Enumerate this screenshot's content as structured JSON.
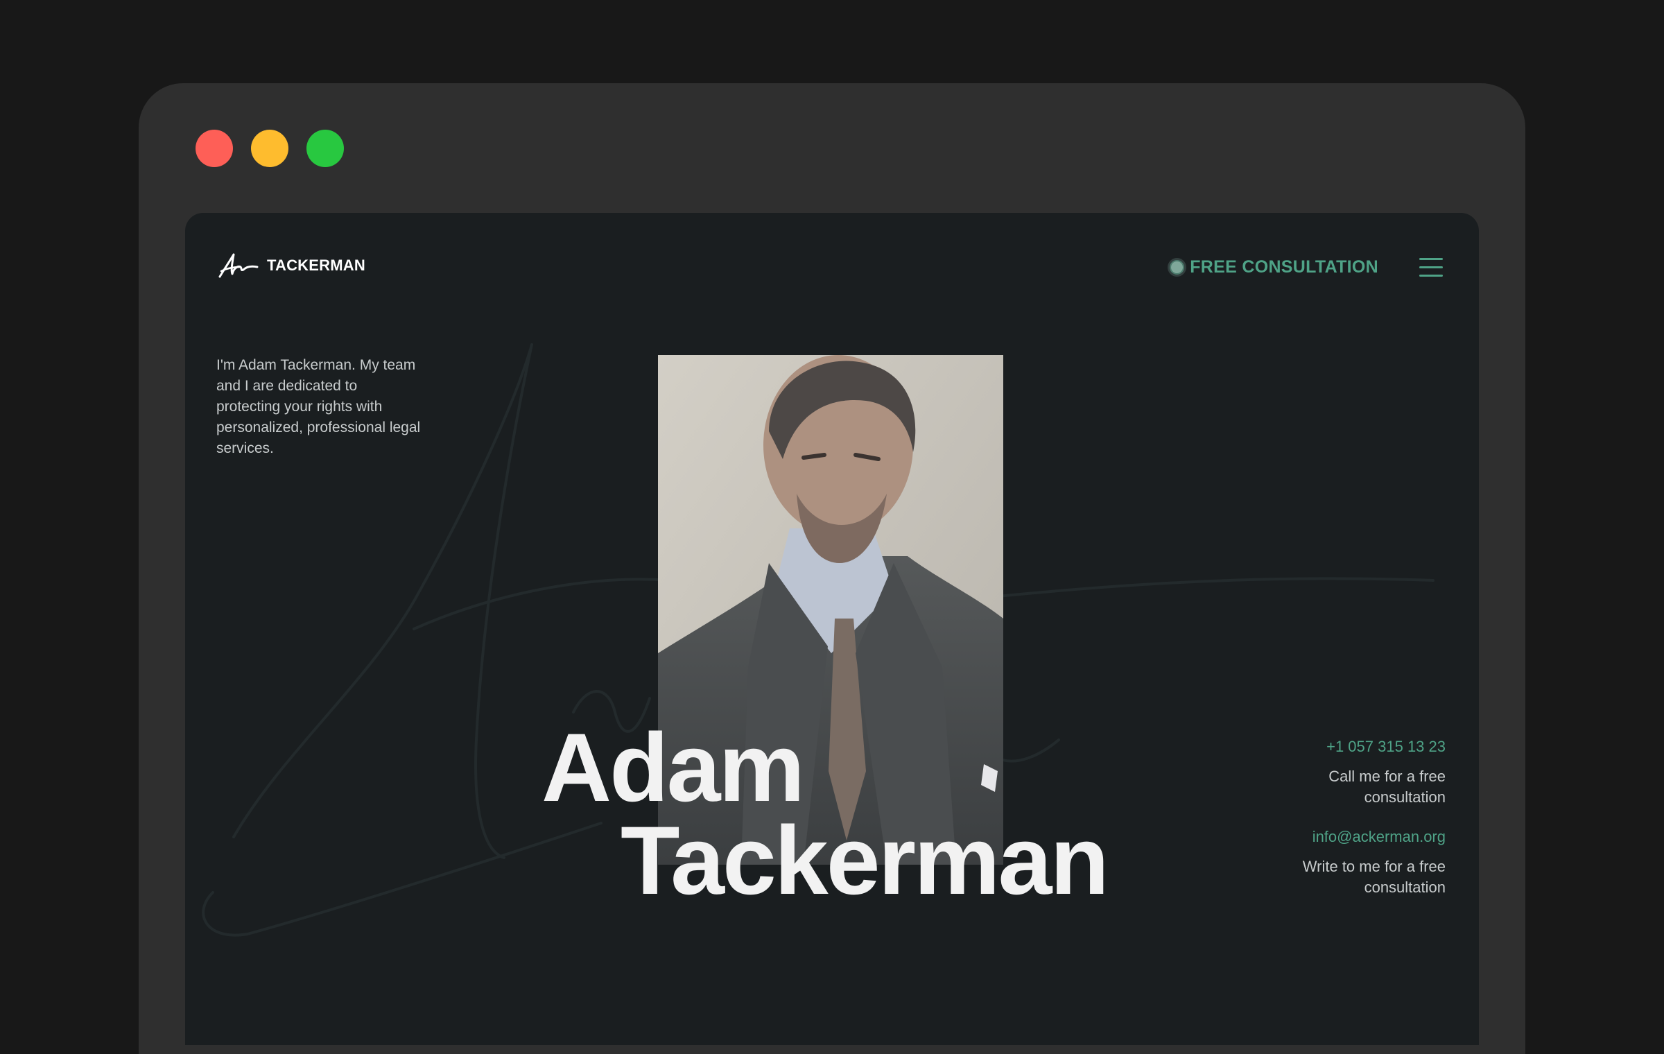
{
  "window": {
    "controls": [
      "close",
      "minimize",
      "maximize"
    ],
    "colors": {
      "close": "#fe5f57",
      "minimize": "#febc2e",
      "maximize": "#28c840"
    }
  },
  "header": {
    "brand": "TACKERMAN",
    "cta_label": "FREE CONSULTATION",
    "menu_icon": "hamburger-icon"
  },
  "intro": {
    "text": "I'm Adam Tackerman. My team and I are dedicated to protecting your rights with personalized, professional legal services."
  },
  "hero": {
    "first_name": "Adam",
    "last_name": "Tackerman"
  },
  "contacts": {
    "phone": "+1 057 315 13 23",
    "phone_note": "Call me for a free consultation",
    "email": "info@ackerman.org",
    "email_note": "Write to me for a free consultation"
  },
  "colors": {
    "page_background": "#1a1e20",
    "accent": "#4fa387",
    "text": "#c8cccd"
  }
}
